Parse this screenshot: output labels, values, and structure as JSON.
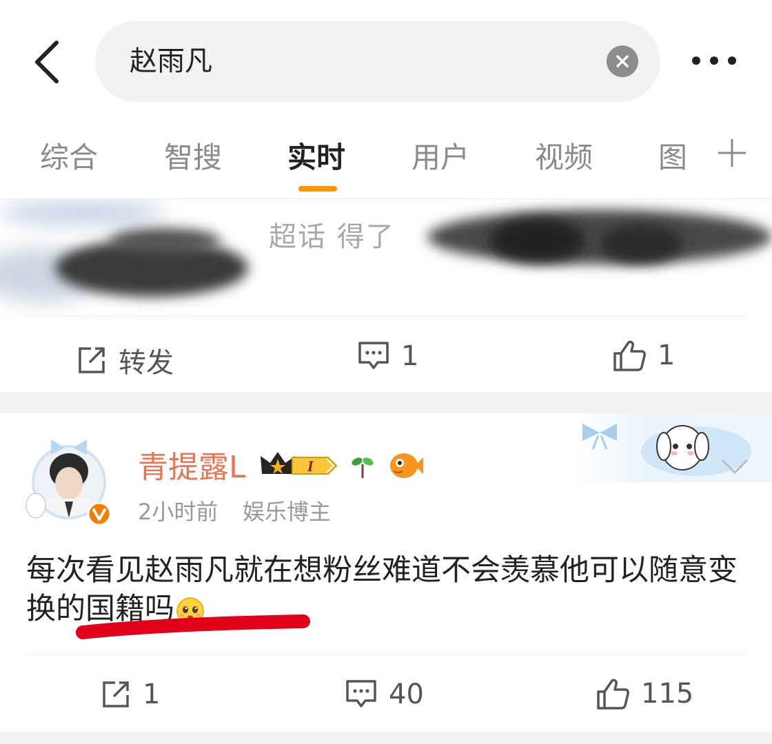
{
  "search": {
    "query": "赵雨凡"
  },
  "tabs": [
    {
      "label": "综合"
    },
    {
      "label": "智搜"
    },
    {
      "label": "实时"
    },
    {
      "label": "用户"
    },
    {
      "label": "视频"
    },
    {
      "label": "图"
    }
  ],
  "active_tab": "实时",
  "post1": {
    "partial_text": "超话 得了",
    "repost_label": "转发",
    "comment_count": "1",
    "like_count": "1"
  },
  "post2": {
    "username": "青提露L",
    "level_badge": "I",
    "time": "2小时前",
    "role": "娱乐博主",
    "text": "每次看见赵雨凡就在想粉丝难道不会羡慕他可以随意变换的国籍吗",
    "repost_count": "1",
    "comment_count": "40",
    "like_count": "115"
  },
  "colors": {
    "accent": "#ff9500",
    "username": "#eb7350",
    "verified": "#f27d00",
    "annotation": "#e3001b"
  },
  "icons": [
    "back-arrow-icon",
    "clear-icon",
    "more-icon",
    "plus-icon",
    "repost-icon",
    "comment-icon",
    "like-icon",
    "verified-icon",
    "crown-icon",
    "sprout-icon",
    "fish-icon",
    "dropdown-chevron-icon",
    "emoji-icon"
  ]
}
